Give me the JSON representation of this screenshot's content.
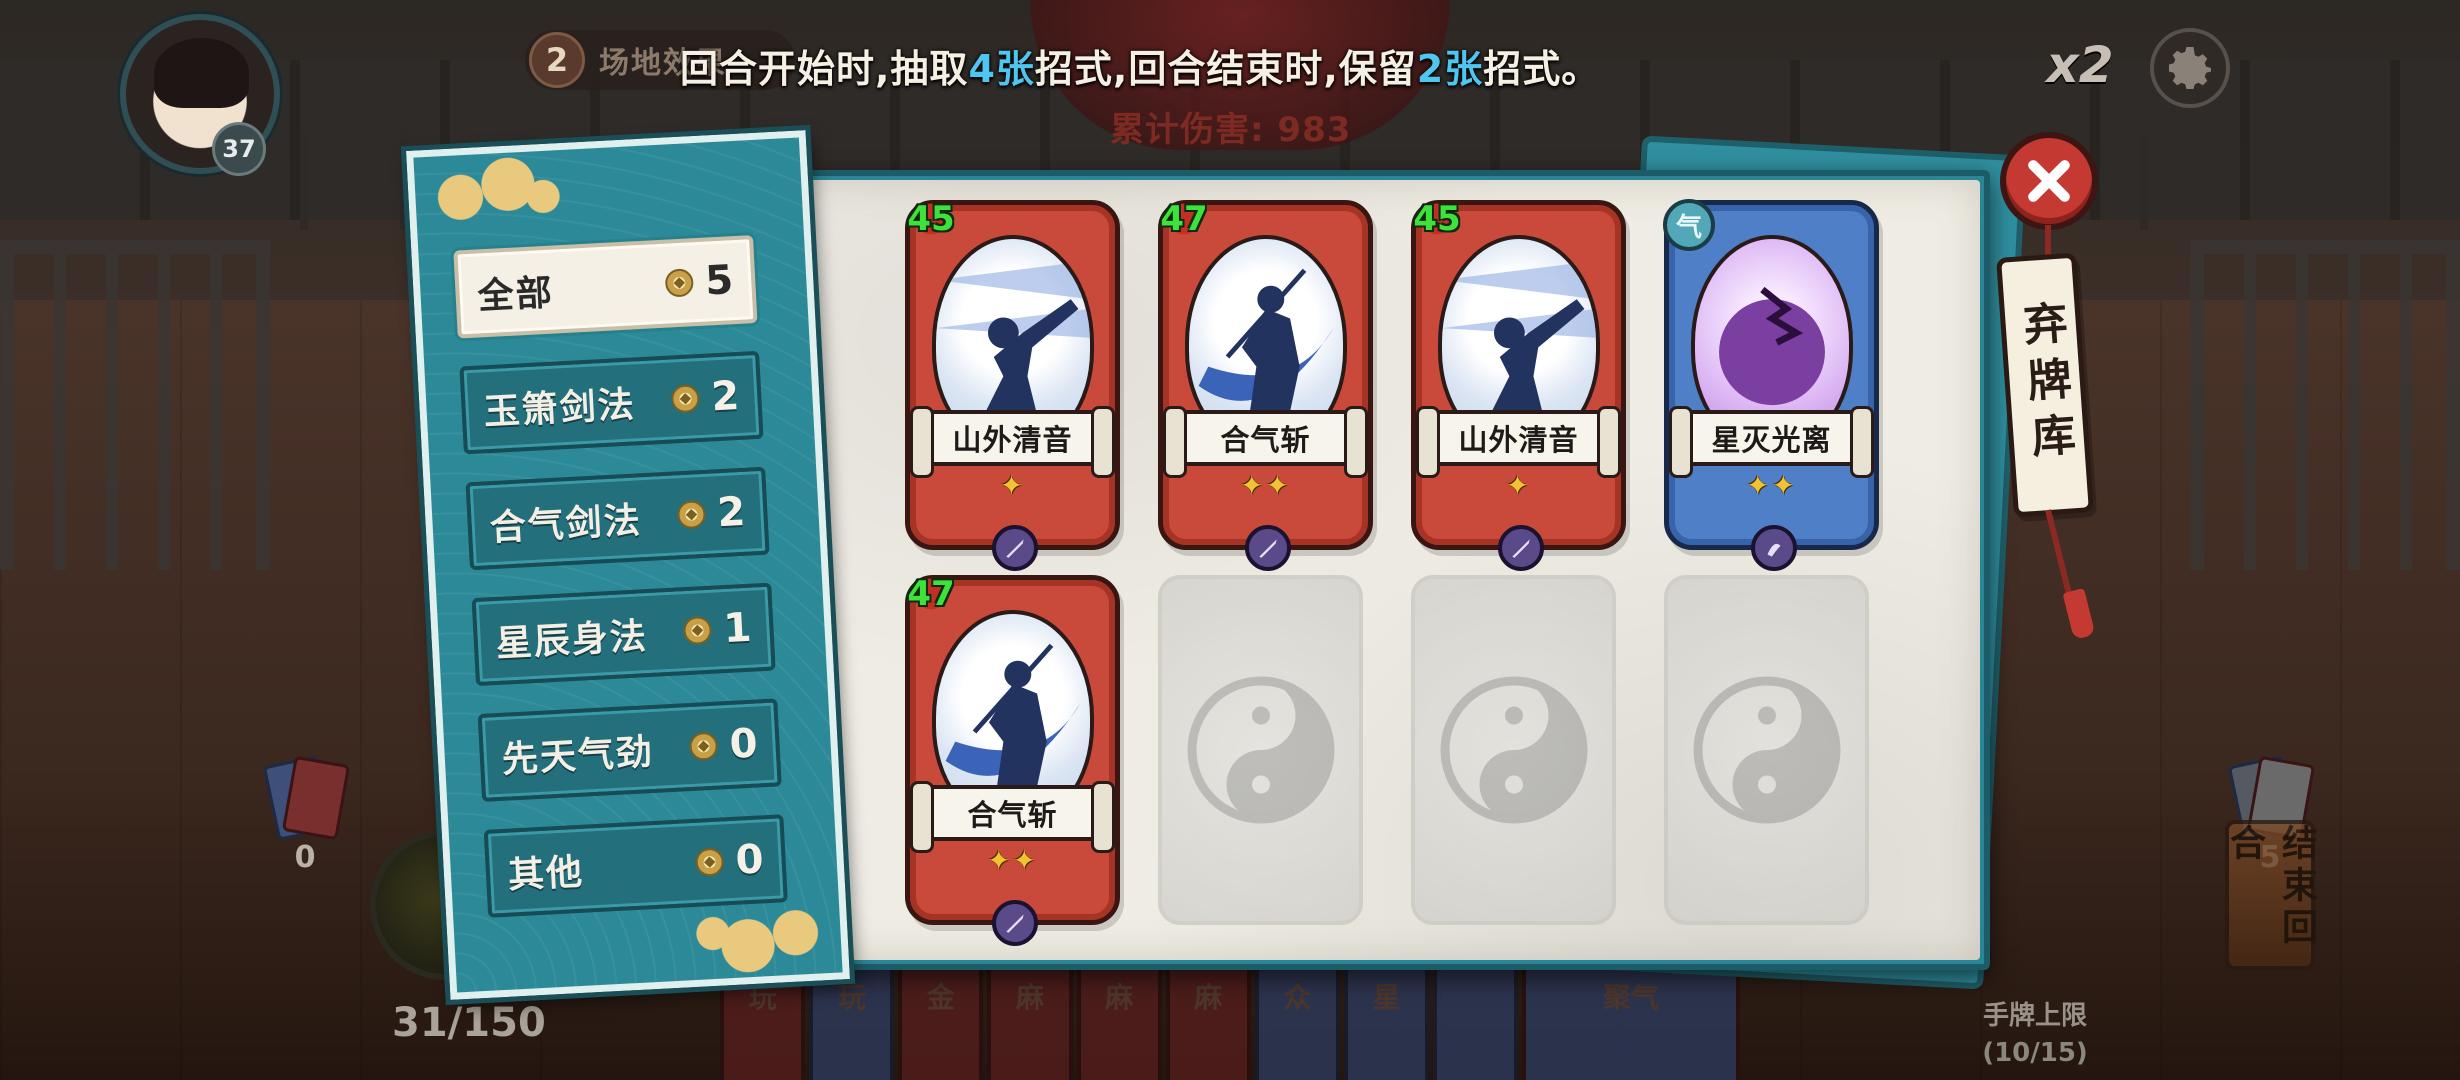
{
  "hud": {
    "player_level": "37",
    "field_effect_number": "2",
    "field_effect_label": "场地效果",
    "damage_text": "累计伤害: 983",
    "rule_banner": {
      "part1": "回合开始时,抽取",
      "draw_count": "4张",
      "part2": "招式,回合结束时,保留",
      "keep_count": "2张",
      "part3": "招式。"
    },
    "speed_label": "x2",
    "left_pile_count": "0",
    "right_pile_count": "5",
    "hp_text": "31/150",
    "hand_limit_label": "手牌上限",
    "hand_limit_value": "(10/15)",
    "end_turn_label": "结束回合",
    "hand_cards": [
      "玩",
      "玩",
      "金",
      "麻",
      "麻",
      "麻",
      "众",
      "星",
      "",
      "聚气"
    ]
  },
  "discard": {
    "tag_label": "弃牌库",
    "tabs": [
      {
        "label": "全部",
        "count": "5",
        "active": true
      },
      {
        "label": "玉箫剑法",
        "count": "2",
        "active": false
      },
      {
        "label": "合气剑法",
        "count": "2",
        "active": false
      },
      {
        "label": "星辰身法",
        "count": "1",
        "active": false
      },
      {
        "label": "先天气劲",
        "count": "0",
        "active": false
      },
      {
        "label": "其他",
        "count": "0",
        "active": false
      }
    ],
    "cards": [
      {
        "name": "山外清音",
        "cost": "45",
        "stars": "✦",
        "color": "red",
        "art": "kick-icon"
      },
      {
        "name": "合气斩",
        "cost": "47",
        "stars": "✦✦",
        "color": "red",
        "art": "slash-icon"
      },
      {
        "name": "山外清音",
        "cost": "45",
        "stars": "✦",
        "color": "red",
        "art": "kick-icon"
      },
      {
        "name": "星灭光离",
        "cost": "气",
        "stars": "✦✦",
        "color": "blue",
        "art": "void-orb-icon"
      },
      {
        "name": "合气斩",
        "cost": "47",
        "stars": "✦✦",
        "color": "red",
        "art": "slash-icon"
      }
    ],
    "empty_slots": 3
  },
  "colors": {
    "panel_teal": "#2c8a98",
    "card_red": "#c94a3a",
    "card_blue": "#4f7fc7",
    "highlight_blue": "#4fc6f0",
    "cost_green": "#3ee23a"
  }
}
